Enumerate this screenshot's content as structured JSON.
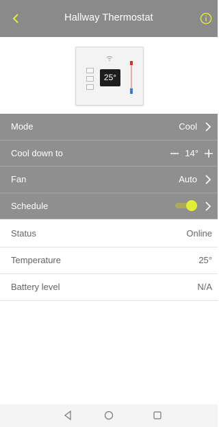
{
  "header": {
    "title": "Hallway Thermostat"
  },
  "device": {
    "temperature_display": "25°"
  },
  "controls": {
    "mode": {
      "label": "Mode",
      "value": "Cool"
    },
    "cool_down": {
      "label": "Cool down to",
      "value": "14°"
    },
    "fan": {
      "label": "Fan",
      "value": "Auto"
    },
    "schedule": {
      "label": "Schedule",
      "enabled": true
    }
  },
  "status": [
    {
      "label": "Status",
      "value": "Online"
    },
    {
      "label": "Temperature",
      "value": "25°"
    },
    {
      "label": "Battery level",
      "value": "N/A"
    }
  ],
  "colors": {
    "header_bg": "#8a8a8a",
    "menu_bg": "#8f8f8f",
    "accent_yellow": "#e4ed36"
  },
  "icons": [
    "back-arrow-icon",
    "info-icon",
    "wifi-icon",
    "chevron-right-icon",
    "minus-icon",
    "plus-icon",
    "nav-back-icon",
    "nav-home-icon",
    "nav-recents-icon"
  ]
}
